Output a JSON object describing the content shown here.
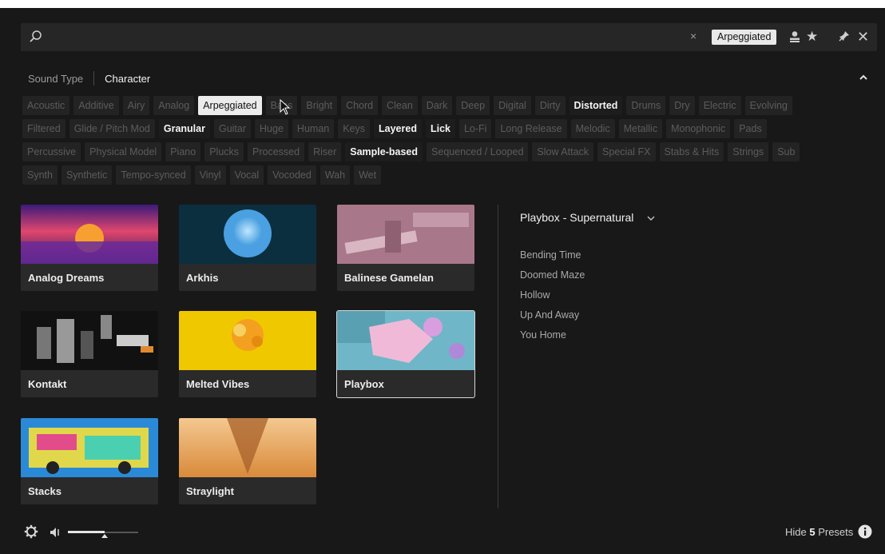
{
  "search": {
    "placeholder": "",
    "value": "",
    "active_filter": "Arpeggiated"
  },
  "tabs": [
    {
      "label": "Sound Type",
      "active": false
    },
    {
      "label": "Character",
      "active": true
    }
  ],
  "tags": {
    "rows": [
      [
        {
          "label": "Acoustic",
          "state": "off"
        },
        {
          "label": "Additive",
          "state": "off"
        },
        {
          "label": "Airy",
          "state": "off"
        },
        {
          "label": "Analog",
          "state": "off"
        },
        {
          "label": "Arpeggiated",
          "state": "highlight"
        },
        {
          "label": "Bass",
          "state": "off"
        },
        {
          "label": "Bright",
          "state": "off"
        },
        {
          "label": "Chord",
          "state": "off"
        },
        {
          "label": "Clean",
          "state": "off"
        },
        {
          "label": "Dark",
          "state": "off"
        },
        {
          "label": "Deep",
          "state": "off"
        },
        {
          "label": "Digital",
          "state": "off"
        },
        {
          "label": "Dirty",
          "state": "off"
        },
        {
          "label": "Distorted",
          "state": "on"
        },
        {
          "label": "Drums",
          "state": "off"
        },
        {
          "label": "Dry",
          "state": "off"
        },
        {
          "label": "Electric",
          "state": "off"
        },
        {
          "label": "Evolving",
          "state": "off"
        }
      ],
      [
        {
          "label": "Filtered",
          "state": "off"
        },
        {
          "label": "Glide / Pitch Mod",
          "state": "off"
        },
        {
          "label": "Granular",
          "state": "on"
        },
        {
          "label": "Guitar",
          "state": "off"
        },
        {
          "label": "Huge",
          "state": "off"
        },
        {
          "label": "Human",
          "state": "off"
        },
        {
          "label": "Keys",
          "state": "off"
        },
        {
          "label": "Layered",
          "state": "on"
        },
        {
          "label": "Lick",
          "state": "on"
        },
        {
          "label": "Lo-Fi",
          "state": "off"
        },
        {
          "label": "Long Release",
          "state": "off"
        },
        {
          "label": "Melodic",
          "state": "off"
        },
        {
          "label": "Metallic",
          "state": "off"
        },
        {
          "label": "Monophonic",
          "state": "off"
        },
        {
          "label": "Pads",
          "state": "off"
        }
      ],
      [
        {
          "label": "Percussive",
          "state": "off"
        },
        {
          "label": "Physical Model",
          "state": "off"
        },
        {
          "label": "Piano",
          "state": "off"
        },
        {
          "label": "Plucks",
          "state": "off"
        },
        {
          "label": "Processed",
          "state": "off"
        },
        {
          "label": "Riser",
          "state": "off"
        },
        {
          "label": "Sample-based",
          "state": "on"
        },
        {
          "label": "Sequenced / Looped",
          "state": "off"
        },
        {
          "label": "Slow Attack",
          "state": "off"
        },
        {
          "label": "Special FX",
          "state": "off"
        },
        {
          "label": "Stabs & Hits",
          "state": "off"
        },
        {
          "label": "Strings",
          "state": "off"
        },
        {
          "label": "Sub",
          "state": "off"
        }
      ],
      [
        {
          "label": "Synth",
          "state": "off"
        },
        {
          "label": "Synthetic",
          "state": "off"
        },
        {
          "label": "Tempo-synced",
          "state": "off"
        },
        {
          "label": "Vinyl",
          "state": "off"
        },
        {
          "label": "Vocal",
          "state": "off"
        },
        {
          "label": "Vocoded",
          "state": "off"
        },
        {
          "label": "Wah",
          "state": "off"
        },
        {
          "label": "Wet",
          "state": "off"
        }
      ]
    ]
  },
  "products": [
    {
      "name": "Analog Dreams",
      "selected": false
    },
    {
      "name": "Arkhis",
      "selected": false
    },
    {
      "name": "Balinese Gamelan",
      "selected": false
    },
    {
      "name": "Kontakt",
      "selected": false
    },
    {
      "name": "Melted Vibes",
      "selected": false
    },
    {
      "name": "Playbox",
      "selected": true
    },
    {
      "name": "Stacks",
      "selected": false
    },
    {
      "name": "Straylight",
      "selected": false
    }
  ],
  "presets": {
    "header": "Playbox - Supernatural",
    "items": [
      "Bending Time",
      "Doomed Maze",
      "Hollow",
      "Up And Away",
      "You Home"
    ]
  },
  "footer": {
    "volume": 0.52,
    "hide_prefix": "Hide ",
    "hide_count": "5",
    "hide_suffix": " Presets"
  },
  "colors": {
    "background": "#181818",
    "chip_highlight": "#ececec"
  }
}
